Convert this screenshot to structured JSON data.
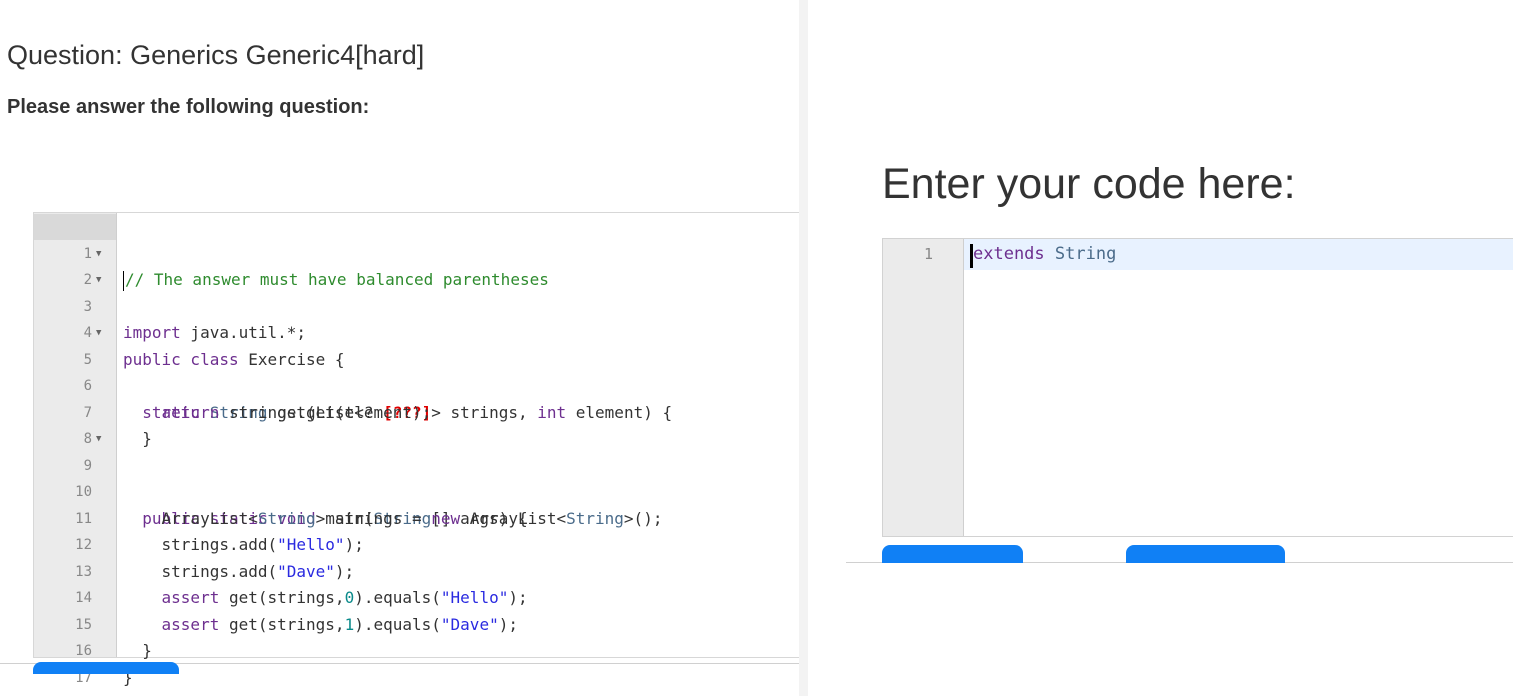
{
  "question": {
    "title": "Question: Generics Generic4[hard]",
    "subtitle": "Please answer the following question:"
  },
  "code_editor": {
    "line_numbers": [
      "1",
      "2",
      "3",
      "4",
      "5",
      "6",
      "7",
      "8",
      "9",
      "10",
      "11",
      "12",
      "13",
      "14",
      "15",
      "16",
      "17"
    ],
    "lines": {
      "l1": "// The answer must have balanced parentheses",
      "l2_kw": "import",
      "l2_rest": " java.util.*;",
      "l3_kw": "public class",
      "l3_rest": " Exercise {",
      "l5_kw": "static",
      "l5_type": "String",
      "l5_a": " get(List<? ",
      "l5_blank": "[???]",
      "l5_b": "> strings, ",
      "l5_kw2": "int",
      "l5_c": " element) {",
      "l6_kw": "return",
      "l6_rest": " strings.get(element);",
      "l7": "}",
      "l9_kw": "public static void",
      "l9_a": " main(",
      "l9_type": "String",
      "l9_b": "[] args) {",
      "l10_a": "ArrayList<",
      "l10_type1": "String",
      "l10_b": "> strings = ",
      "l10_kw": "new",
      "l10_c": " ArrayList<",
      "l10_type2": "String",
      "l10_d": ">();",
      "l11_a": "strings.add(",
      "l11_str": "\"Hello\"",
      "l11_b": ");",
      "l12_a": "strings.add(",
      "l12_str": "\"Dave\"",
      "l12_b": ");",
      "l13_kw": "assert",
      "l13_a": " get(strings,",
      "l13_num": "0",
      "l13_b": ").equals(",
      "l13_str": "\"Hello\"",
      "l13_c": ");",
      "l14_kw": "assert",
      "l14_a": " get(strings,",
      "l14_num": "1",
      "l14_b": ").equals(",
      "l14_str": "\"Dave\"",
      "l14_c": ");",
      "l15": "}",
      "l16": "}"
    }
  },
  "answer": {
    "heading": "Enter your code here:",
    "line_number": "1",
    "code_kw": "extends",
    "code_type": "String"
  },
  "colors": {
    "button": "#1080f5",
    "comment": "#2e8b2e",
    "keyword": "#6d2f8f",
    "string": "#2a2ae0",
    "blank_marker": "#e00000"
  }
}
